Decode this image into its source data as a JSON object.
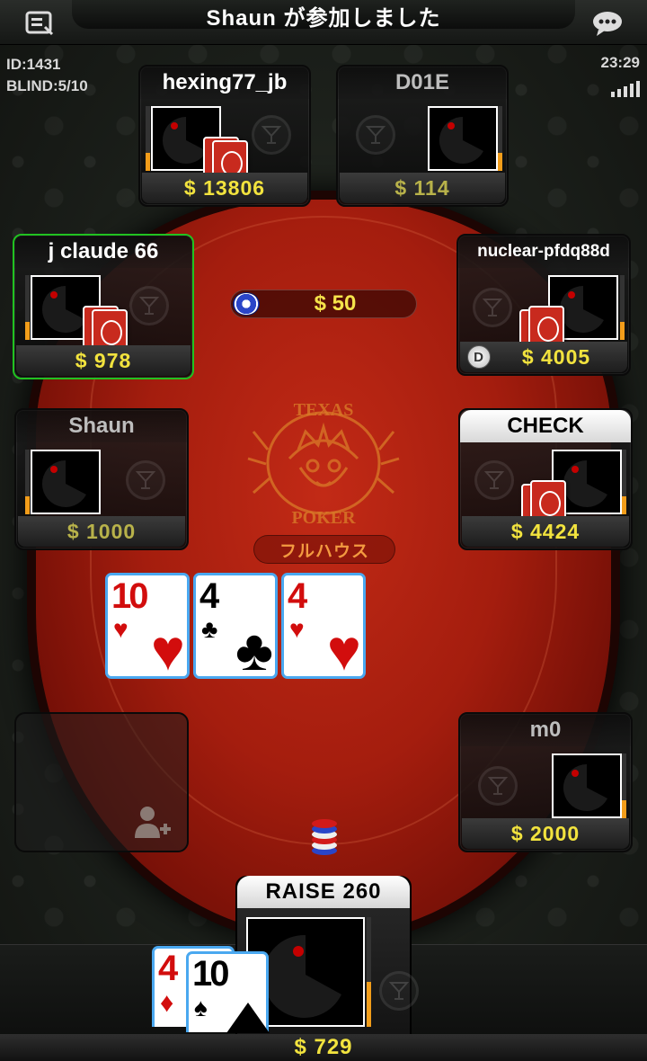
{
  "header": {
    "title": "Shaun が参加しました",
    "menu_icon": "menu-list-icon",
    "chat_icon": "chat-bubble-icon"
  },
  "info": {
    "table_id": "ID:1431",
    "blind": "BLIND:5/10",
    "time": "23:29"
  },
  "pot": {
    "amount": "$ 50"
  },
  "hand_name": "フルハウス",
  "community_cards": [
    {
      "rank": "10",
      "suit": "♥",
      "color": "#d20d0d"
    },
    {
      "rank": "4",
      "suit": "♣",
      "color": "#000000"
    },
    {
      "rank": "4",
      "suit": "♥",
      "color": "#d20d0d"
    }
  ],
  "seats": [
    {
      "name": "hexing77_jb",
      "stack": "$ 13806",
      "status": ""
    },
    {
      "name": "D01E",
      "stack": "$ 114",
      "status": ""
    },
    {
      "name": "j claude 66",
      "stack": "$ 978",
      "status": "active"
    },
    {
      "name": "nuclear-pfdq88d",
      "stack": "$ 4005",
      "status": "",
      "dealer": "D"
    },
    {
      "name": "Shaun",
      "stack": "$ 1000",
      "status": ""
    },
    {
      "name": "CHECK",
      "stack": "$ 4424",
      "status": ""
    },
    {
      "name": "m0",
      "stack": "$ 2000",
      "status": ""
    }
  ],
  "empty_seat": {
    "icon": "add-user-icon"
  },
  "me": {
    "action": "RAISE 260",
    "stack": "$ 729",
    "hole_cards": [
      {
        "rank": "4",
        "suit": "♦",
        "color": "#d20d0d"
      },
      {
        "rank": "10",
        "suit": "♠",
        "color": "#000000"
      }
    ]
  },
  "colors": {
    "stack_yellow": "#f2e33e",
    "felt_red": "#b22312",
    "active_border": "#21c221",
    "timer_orange": "#f29d1a",
    "hand_label": "#f39a40"
  }
}
